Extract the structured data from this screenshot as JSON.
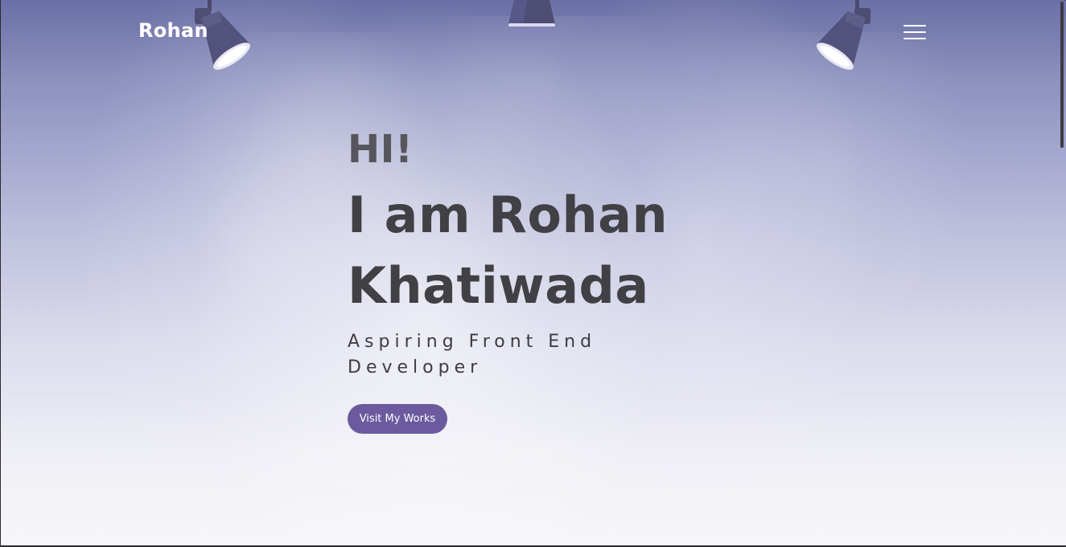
{
  "nav": {
    "logo": "Rohan",
    "menu_icon": "hamburger-menu-icon"
  },
  "hero": {
    "greeting": "HI!",
    "name_line1": "I am Rohan",
    "name_line2": "Khatiwada",
    "tagline": "Aspiring Front End Developer",
    "cta_label": "Visit My Works"
  },
  "decor": {
    "lamp_icon": "spotlight-lamp-icon",
    "lamp_count": 3
  },
  "colors": {
    "accent": "#6b5a9e",
    "heading": "#404045",
    "greeting": "#56565c",
    "background_top": "#6a6fa6",
    "background_bottom": "#f7f7fa"
  }
}
